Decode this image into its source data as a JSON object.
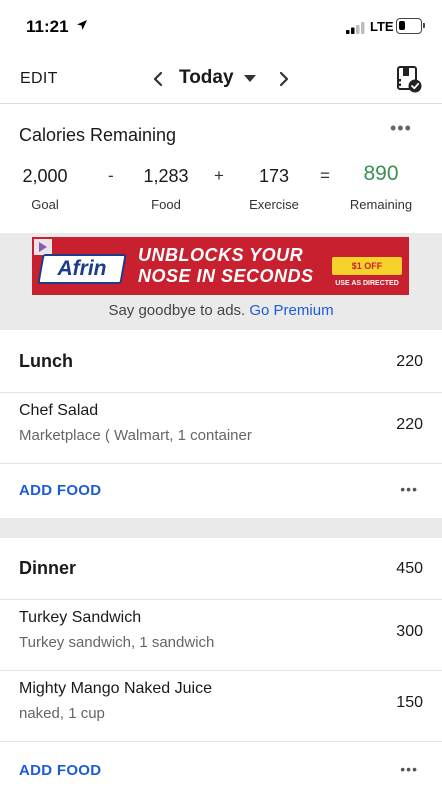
{
  "status": {
    "time": "11:21",
    "network": "LTE",
    "battery_level": 0.3
  },
  "nav": {
    "edit_label": "EDIT",
    "date": "Today"
  },
  "calories": {
    "title": "Calories Remaining",
    "goal_value": "2,000",
    "goal_label": "Goal",
    "minus": "-",
    "food_value": "1,283",
    "food_label": "Food",
    "plus": "+",
    "exercise_value": "173",
    "exercise_label": "Exercise",
    "equals": "=",
    "remaining_value": "890",
    "remaining_label": "Remaining"
  },
  "ad": {
    "brand": "Afrin",
    "headline_line1": "UNBLOCKS YOUR",
    "headline_line2": "NOSE IN SECONDS",
    "offer": "$1 OFF",
    "fine_print": "USE AS DIRECTED",
    "promo_text": "Say goodbye to ads.",
    "promo_link": "Go Premium"
  },
  "meals": [
    {
      "name": "Lunch",
      "calories": "220",
      "foods": [
        {
          "name": "Chef Salad",
          "description": "Marketplace ( Walmart, 1 container",
          "calories": "220"
        }
      ],
      "add_label": "ADD FOOD"
    },
    {
      "name": "Dinner",
      "calories": "450",
      "foods": [
        {
          "name": "Turkey Sandwich",
          "description": "Turkey sandwich, 1 sandwich",
          "calories": "300"
        },
        {
          "name": "Mighty Mango Naked Juice",
          "description": "naked, 1 cup",
          "calories": "150"
        }
      ],
      "add_label": "ADD FOOD"
    }
  ],
  "colors": {
    "accent_blue": "#1d5cd8",
    "remaining_green": "#3a8f52",
    "ad_red": "#c8202f"
  }
}
